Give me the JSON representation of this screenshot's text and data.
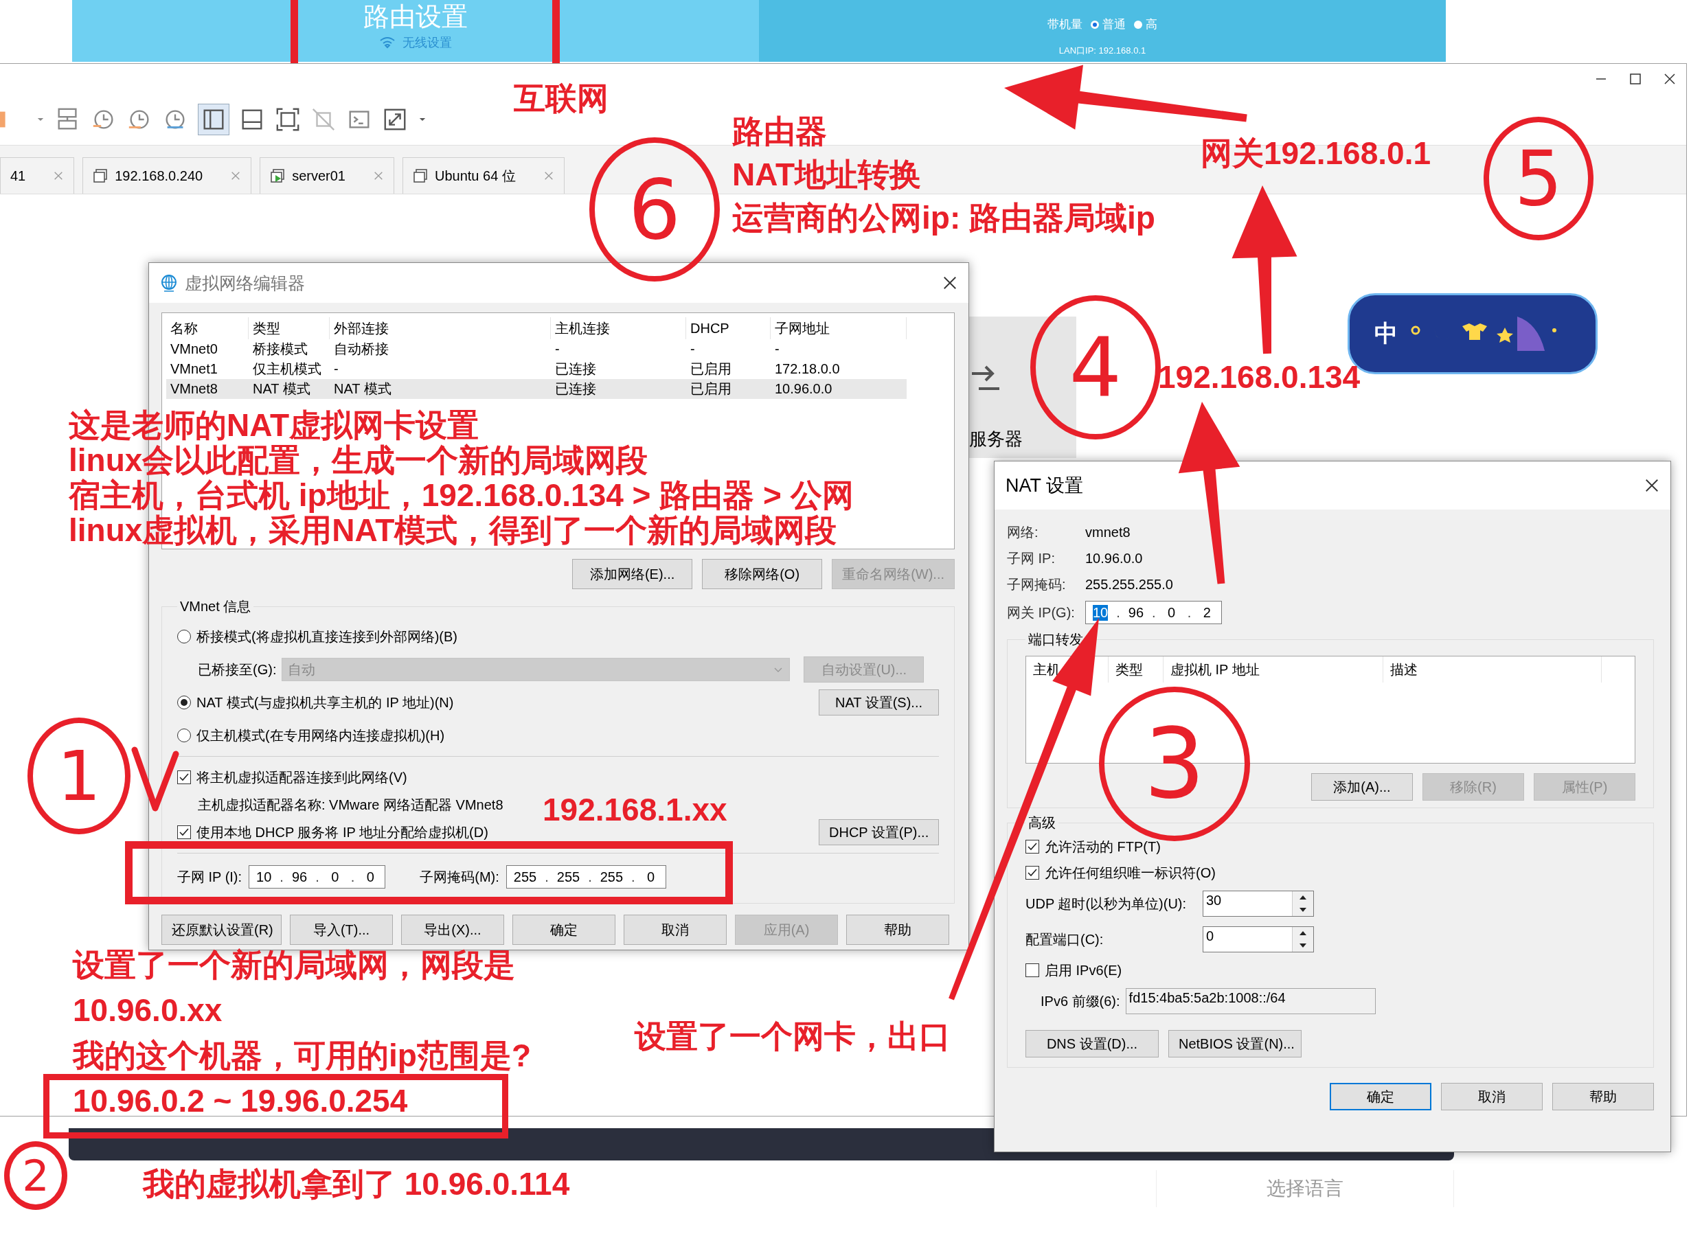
{
  "router_page": {
    "title": "路由设置",
    "subtitle": "无线设置",
    "capacity_label": "带机量",
    "capacity_options": [
      {
        "label": "普通",
        "selected": true
      },
      {
        "label": "高",
        "selected": false
      }
    ],
    "lan_ip": "LAN口IP: 192.168.0.1"
  },
  "workstation": {
    "tabs": [
      {
        "label": "41",
        "selected": false,
        "kind": "plain"
      },
      {
        "label": "192.168.0.240",
        "selected": false,
        "kind": "host"
      },
      {
        "label": "server01",
        "selected": false,
        "kind": "running"
      },
      {
        "label": "Ubuntu 64 位",
        "selected": false,
        "kind": "host"
      }
    ],
    "remote_tile": "服务器",
    "ime_badge": "中",
    "language_button": "选择语言"
  },
  "network_editor": {
    "title": "虚拟网络编辑器",
    "columns": [
      "名称",
      "类型",
      "外部连接",
      "主机连接",
      "DHCP",
      "子网地址"
    ],
    "rows": [
      {
        "cells": [
          "VMnet0",
          "桥接模式",
          "自动桥接",
          "-",
          "-",
          "-"
        ],
        "selected": false
      },
      {
        "cells": [
          "VMnet1",
          "仅主机模式",
          "-",
          "已连接",
          "已启用",
          "172.18.0.0"
        ],
        "selected": false
      },
      {
        "cells": [
          "VMnet8",
          "NAT 模式",
          "NAT 模式",
          "已连接",
          "已启用",
          "10.96.0.0"
        ],
        "selected": true
      }
    ],
    "list_buttons": [
      {
        "label": "添加网络(E)...",
        "disabled": false
      },
      {
        "label": "移除网络(O)",
        "disabled": false
      },
      {
        "label": "重命名网络(W)...",
        "disabled": true
      }
    ],
    "group_title": "VMnet 信息",
    "bridged_mode": {
      "label": "桥接模式(将虚拟机直接连接到外部网络)(B)",
      "selected": false
    },
    "bridged_to": {
      "label": "已桥接至(G):",
      "value": "自动",
      "disabled": true
    },
    "auto_button": {
      "label": "自动设置(U)...",
      "disabled": true
    },
    "nat_mode": {
      "label": "NAT 模式(与虚拟机共享主机的 IP 地址)(N)",
      "selected": true
    },
    "nat_button": {
      "label": "NAT 设置(S)...",
      "disabled": false
    },
    "host_only_mode": {
      "label": "仅主机模式(在专用网络内连接虚拟机)(H)",
      "selected": false
    },
    "host_adapter": {
      "label": "将主机虚拟适配器连接到此网络(V)",
      "checked": true
    },
    "adapter_name": "主机虚拟适配器名称: VMware 网络适配器 VMnet8",
    "dhcp": {
      "label": "使用本地 DHCP 服务将 IP 地址分配给虚拟机(D)",
      "checked": true
    },
    "dhcp_button": {
      "label": "DHCP 设置(P)...",
      "disabled": false
    },
    "subnet_ip": {
      "label": "子网 IP (I):",
      "octets": [
        "10",
        "96",
        "0",
        "0"
      ],
      "separator": "."
    },
    "subnet_mask": {
      "label": "子网掩码(M):",
      "octets": [
        "255",
        "255",
        "255",
        "0"
      ],
      "separator": "."
    },
    "footer_buttons": [
      {
        "label": "还原默认设置(R)",
        "disabled": false
      },
      {
        "label": "导入(T)...",
        "disabled": false
      },
      {
        "label": "导出(X)...",
        "disabled": false
      },
      {
        "label": "确定",
        "disabled": false
      },
      {
        "label": "取消",
        "disabled": false
      },
      {
        "label": "应用(A)",
        "disabled": true
      },
      {
        "label": "帮助",
        "disabled": false
      }
    ]
  },
  "nat_settings": {
    "title": "NAT 设置",
    "info": [
      {
        "label": "网络:",
        "value": "vmnet8"
      },
      {
        "label": "子网 IP:",
        "value": "10.96.0.0"
      },
      {
        "label": "子网掩码:",
        "value": "255.255.255.0"
      }
    ],
    "gateway": {
      "label": "网关 IP(G):",
      "separator": ".",
      "octets": [
        {
          "text": "10",
          "selected": true
        },
        {
          "text": "96",
          "selected": false
        },
        {
          "text": "0",
          "selected": false
        },
        {
          "text": "2",
          "selected": false
        }
      ]
    },
    "port_forwarding": {
      "title": "端口转发",
      "columns": [
        "主机",
        "类型",
        "虚拟机 IP 地址",
        "描述"
      ],
      "buttons": [
        {
          "label": "添加(A)...",
          "disabled": false
        },
        {
          "label": "移除(R)",
          "disabled": true
        },
        {
          "label": "属性(P)",
          "disabled": true
        }
      ]
    },
    "advanced": {
      "title": "高级",
      "checks": [
        {
          "label": "允许活动的 FTP(T)",
          "checked": true
        },
        {
          "label": "允许任何组织唯一标识符(O)",
          "checked": true
        }
      ],
      "udp_timeout": {
        "label": "UDP 超时(以秒为单位)(U):",
        "value": "30"
      },
      "config_port": {
        "label": "配置端口(C):",
        "value": "0"
      },
      "ipv6": {
        "label": "启用 IPv6(E)",
        "checked": false
      },
      "ipv6_prefix": {
        "label": "IPv6 前缀(6):",
        "value": "fd15:4ba5:5a2b:1008::/64"
      },
      "buttons": [
        "DNS 设置(D)...",
        "NetBIOS 设置(N)..."
      ]
    },
    "footer_buttons": [
      {
        "label": "确定",
        "default": true
      },
      {
        "label": "取消",
        "default": false
      },
      {
        "label": "帮助",
        "default": false
      }
    ]
  },
  "annotations": {
    "notes": [
      {
        "lines": [
          "互联网"
        ]
      },
      {
        "lines": [
          "路由器",
          "NAT地址转换",
          "运营商的公网ip: 路由器局域ip"
        ]
      },
      {
        "lines": [
          "网关192.168.0.1"
        ]
      },
      {
        "lines": [
          "192.168.0.134"
        ]
      },
      {
        "lines": [
          "这是老师的NAT虚拟网卡设置",
          "linux会以此配置，生成一个新的局域网段",
          "宿主机，台式机 ip地址，192.168.0.134 > 路由器 > 公网",
          "linux虚拟机，采用NAT模式，得到了一个新的局域网段"
        ]
      },
      {
        "lines": [
          "192.168.1.xx"
        ]
      },
      {
        "lines": [
          "设置了一个新的局域网，网段是",
          "10.96.0.xx",
          "我的这个机器，可用的ip范围是?",
          "10.96.0.2 ~ 19.96.0.254"
        ]
      },
      {
        "lines": [
          "设置了一个网卡，出口"
        ]
      },
      {
        "lines": [
          "我的虚拟机拿到了 10.96.0.114"
        ]
      }
    ],
    "circled_numbers": [
      "6",
      "5",
      "4",
      "3",
      "1",
      "2"
    ]
  }
}
